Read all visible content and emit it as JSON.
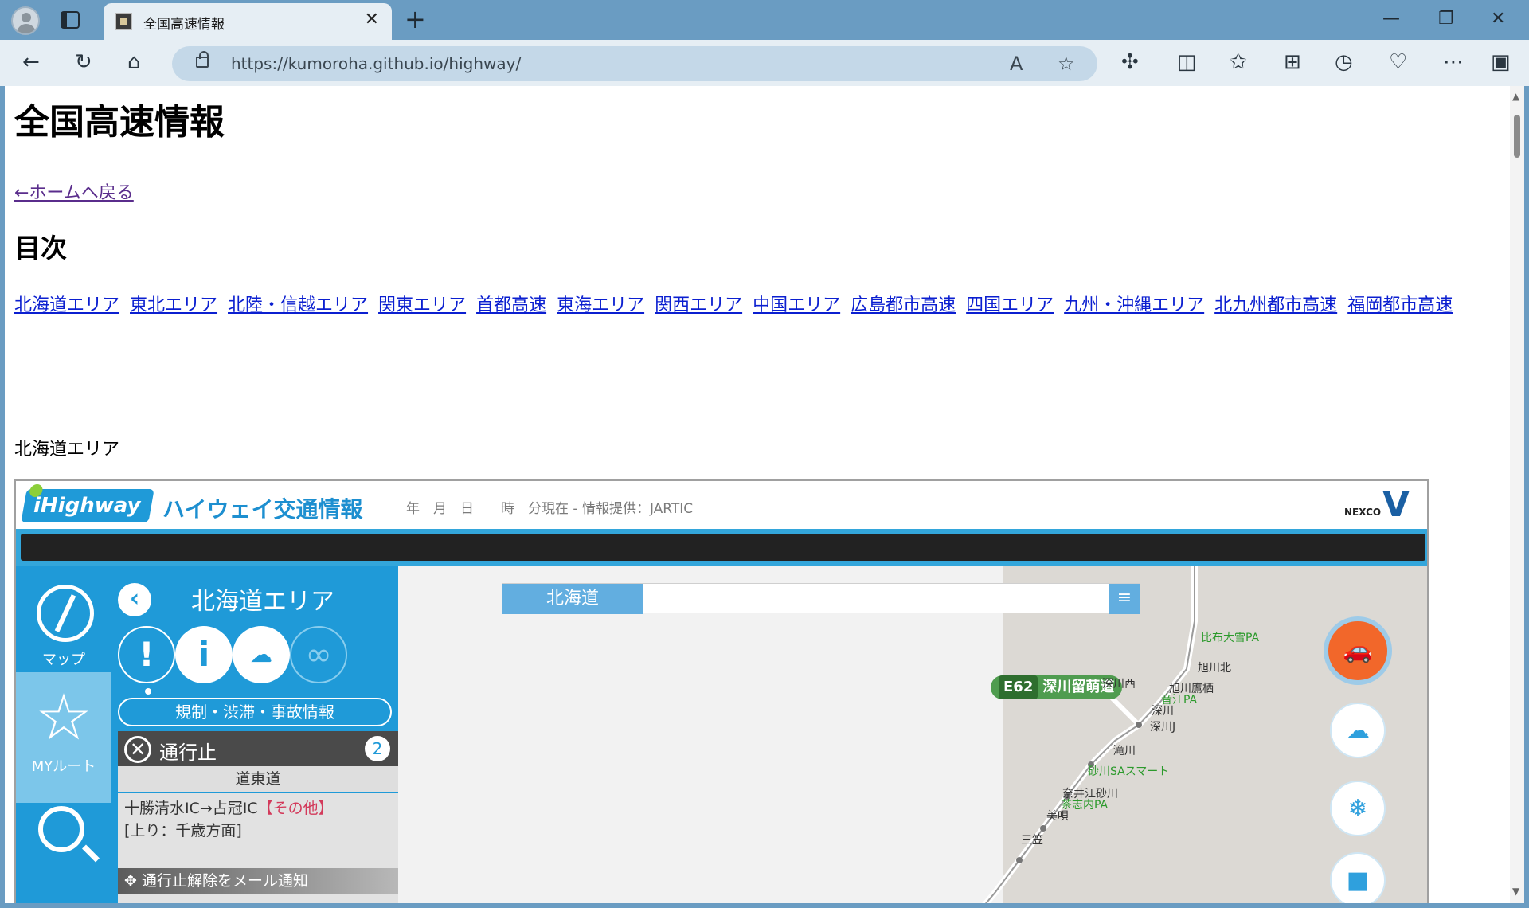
{
  "browser": {
    "tab_title": "全国高速情報",
    "new_tab": "+",
    "tab_close": "✕",
    "window": {
      "minimize": "—",
      "maximize": "❐",
      "close": "✕"
    },
    "url": "https://kumoroha.github.io/highway/"
  },
  "page": {
    "title": "全国高速情報",
    "back_link": "←ホームへ戻る",
    "toc_heading": "目次",
    "toc_links": [
      "北海道エリア",
      "東北エリア",
      "北陸・信越エリア",
      "関東エリア",
      "首都高速",
      "東海エリア",
      "関西エリア",
      "中国エリア",
      "広島都市高速",
      "四国エリア",
      "九州・沖縄エリア",
      "北九州都市高速",
      "福岡都市高速"
    ],
    "section_label": "北海道エリア"
  },
  "ihighway": {
    "logo": "iHighway",
    "title": "ハイウェイ交通情報",
    "date_line": "年　月　日　　時　分現在 - 情報提供：JARTIC",
    "nexco": "NEXCO",
    "sidebar": {
      "map_label": "マップ",
      "myroute_label": "MYルート"
    },
    "panel": {
      "title": "北海道エリア",
      "tab_label": "規制・渋滞・事故情報",
      "closed_label": "通行止",
      "closed_count": "2",
      "road_name": "道東道",
      "section": "十勝清水IC→占冠IC",
      "section_tag": "【その他】",
      "direction": "[上り：千歳方面]",
      "notify": "通行止解除をメール通知"
    },
    "map": {
      "region": "北海道",
      "road_code": "E62",
      "road_name": "深川留萌道",
      "places": [
        "比布大雪PA",
        "旭川北",
        "旭川鷹栖",
        "音江PA",
        "深川西",
        "深川",
        "深川J",
        "滝川",
        "砂川SAスマート",
        "奈井江砂川",
        "茶志内PA",
        "美唄",
        "三笠"
      ]
    }
  }
}
